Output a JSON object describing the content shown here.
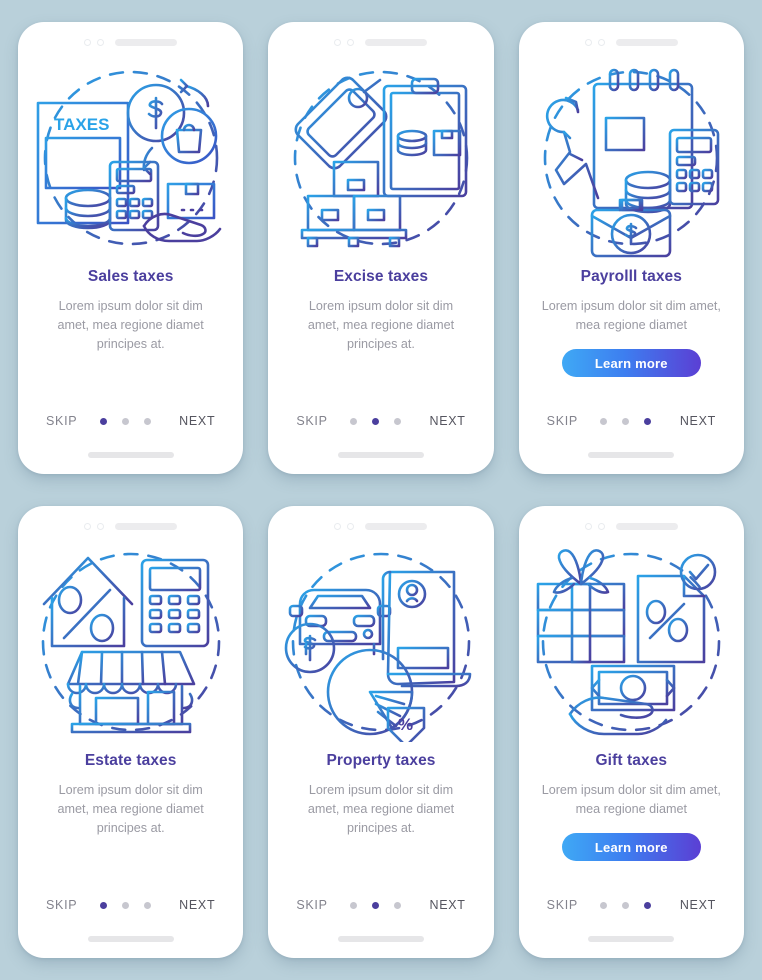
{
  "page": {
    "background_color": "#b9d0da",
    "card_background": "#ffffff",
    "title_color": "#4b3f9e",
    "description_color": "#9a9aa3",
    "accent_gradient_from": "#3fa9f5",
    "accent_gradient_to": "#5b3fd4",
    "dot_active_color": "#4b3f9e",
    "dot_inactive_color": "#c7c7cf"
  },
  "common": {
    "skip_label": "SKIP",
    "next_label": "NEXT",
    "learn_more_label": "Learn more",
    "description_3line": "Lorem ipsum dolor sit dim amet, mea regione diamet principes at.",
    "description_2line": "Lorem ipsum dolor sit dim amet, mea regione diamet"
  },
  "screens": [
    {
      "id": "sales-taxes",
      "title": "Sales taxes",
      "description": "Lorem ipsum dolor sit dim amet, mea regione diamet principes at.",
      "has_learn_more": false,
      "learn_more_label": "Learn more",
      "skip_label": "SKIP",
      "next_label": "NEXT",
      "dots": 3,
      "active_dot": 0,
      "illustration": "taxes-form-calculator-dollar-shopping-bag-parcel-hand"
    },
    {
      "id": "excise-taxes",
      "title": "Excise taxes",
      "description": "Lorem ipsum dolor sit dim amet, mea regione diamet principes at.",
      "has_learn_more": false,
      "learn_more_label": "Learn more",
      "skip_label": "SKIP",
      "next_label": "NEXT",
      "dots": 3,
      "active_dot": 1,
      "illustration": "price-tag-clipboard-coins-boxes-pallet"
    },
    {
      "id": "payroll-taxes",
      "title": "Payrolll taxes",
      "description": "Lorem ipsum dolor sit dim amet, mea regione diamet",
      "has_learn_more": true,
      "learn_more_label": "Learn more",
      "skip_label": "SKIP",
      "next_label": "NEXT",
      "dots": 3,
      "active_dot": 2,
      "illustration": "calendar-report-calculator-wrench-briefcase-dollar"
    },
    {
      "id": "estate-taxes",
      "title": "Estate taxes",
      "description": "Lorem ipsum dolor sit dim amet, mea regione diamet principes at.",
      "has_learn_more": false,
      "learn_more_label": "Learn more",
      "skip_label": "SKIP",
      "next_label": "NEXT",
      "dots": 3,
      "active_dot": 0,
      "illustration": "house-percent-calculator-storefront"
    },
    {
      "id": "property-taxes",
      "title": "Property taxes",
      "description": "Lorem ipsum dolor sit dim amet, mea regione diamet principes at.",
      "has_learn_more": false,
      "learn_more_label": "Learn more",
      "skip_label": "SKIP",
      "next_label": "NEXT",
      "dots": 3,
      "active_dot": 1,
      "illustration": "car-dollar-document-pie-chart-percent"
    },
    {
      "id": "gift-taxes",
      "title": "Gift taxes",
      "description": "Lorem ipsum dolor sit dim amet, mea regione diamet",
      "has_learn_more": true,
      "learn_more_label": "Learn more",
      "skip_label": "SKIP",
      "next_label": "NEXT",
      "dots": 3,
      "active_dot": 2,
      "illustration": "gift-box-percent-document-check-banknote-hand"
    }
  ]
}
